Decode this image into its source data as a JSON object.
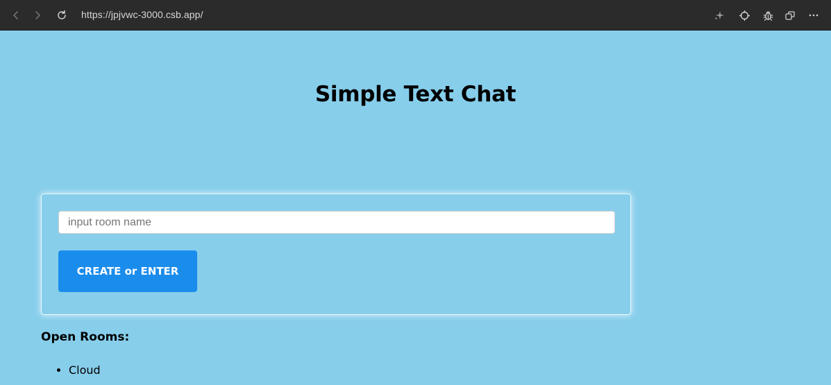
{
  "browser": {
    "url": "https://jpjvwc-3000.csb.app/",
    "icons": [
      "back-icon",
      "forward-icon",
      "reload-icon",
      "sparkle-icon",
      "crosshair-icon",
      "bug-icon",
      "new-window-icon",
      "more-icon"
    ],
    "bar_color": "#2b2b2b"
  },
  "page": {
    "background_color": "#87CEEB",
    "title": "Simple Text Chat",
    "room_form": {
      "input_placeholder": "input room name",
      "input_value": "",
      "button_label": "CREATE or ENTER",
      "button_color": "#1a8cec"
    },
    "open_rooms": {
      "heading": "Open Rooms:",
      "rooms": [
        {
          "name": "Cloud"
        }
      ]
    }
  }
}
